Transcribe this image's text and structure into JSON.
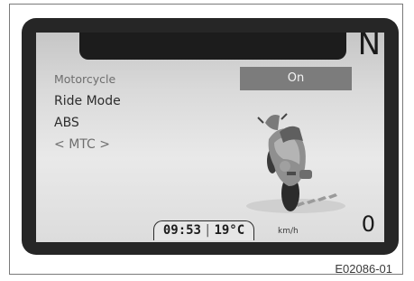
{
  "display": {
    "gear": "N",
    "menu_items": [
      {
        "label": "Motorcycle",
        "state": "selected"
      },
      {
        "label": "Ride Mode",
        "state": "normal"
      },
      {
        "label": "ABS",
        "state": "normal"
      },
      {
        "label": "MTC",
        "state": "faded",
        "prefix": "<",
        "suffix": ">"
      }
    ],
    "selected_value": "On",
    "clock": "09:53",
    "separator": "|",
    "temperature": "19°C",
    "speed_unit": "km/h",
    "speed": "0"
  },
  "figure_code": "E02086-01",
  "colors": {
    "bezel": "#262626",
    "value_box": "#7c7c7c"
  },
  "icons": {
    "illustration": "motorcycle-illustration"
  }
}
